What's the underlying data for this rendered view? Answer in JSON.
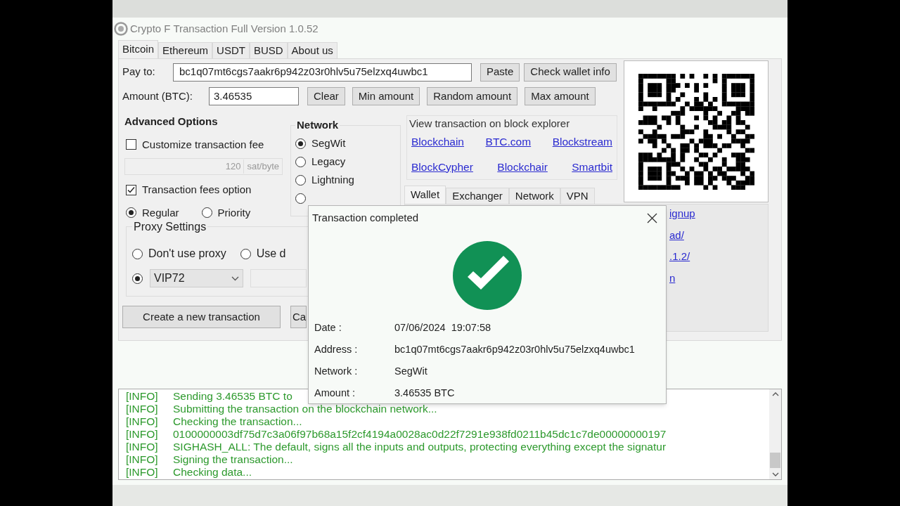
{
  "window": {
    "title": "Crypto F Transaction Full Version 1.0.52"
  },
  "tabs": [
    {
      "label": "Bitcoin",
      "selected": true
    },
    {
      "label": "Ethereum",
      "selected": false
    },
    {
      "label": "USDT",
      "selected": false
    },
    {
      "label": "BUSD",
      "selected": false
    },
    {
      "label": "About us",
      "selected": false
    }
  ],
  "pay_to": {
    "label": "Pay to:",
    "value": "bc1q07mt6cgs7aakr6p942z03r0hlv5u75elzxq4uwbc1",
    "buttons": [
      "Paste",
      "Check wallet info"
    ]
  },
  "amount": {
    "label": "Amount (BTC):",
    "value": "3.46535",
    "buttons": [
      "Clear",
      "Min amount",
      "Random amount",
      "Max amount"
    ]
  },
  "advanced_options": {
    "title": "Advanced Options",
    "customize_fee": {
      "label": "Customize transaction fee",
      "checked": false
    },
    "fee_value": "120",
    "fee_unit": "sat/byte",
    "fees_option": {
      "label": "Transaction fees option",
      "checked": true
    },
    "fee_modes": [
      {
        "label": "Regular",
        "selected": true
      },
      {
        "label": "Priority",
        "selected": false
      }
    ]
  },
  "network": {
    "title": "Network",
    "options": [
      {
        "label": "SegWit",
        "selected": true
      },
      {
        "label": "Legacy",
        "selected": false
      },
      {
        "label": "Lightning",
        "selected": false
      },
      {
        "selected": false
      }
    ]
  },
  "explorer": {
    "title": "View transaction on block explorer",
    "links": [
      "Blockchain",
      "BTC.com",
      "Blockstream",
      "BlockCypher",
      "Blockchair",
      "Smartbit"
    ]
  },
  "inner_tabs": [
    {
      "label": "Wallet",
      "selected": true
    },
    {
      "label": "Exchanger",
      "selected": false
    },
    {
      "label": "Network",
      "selected": false
    },
    {
      "label": "VPN",
      "selected": false
    }
  ],
  "inner_links": [
    "ignup",
    "ad/",
    ".1.2/",
    "n"
  ],
  "proxy": {
    "title": "Proxy Settings",
    "options": [
      {
        "label": "Don't use proxy",
        "selected": false
      },
      {
        "label": "Use d",
        "selected": false
      }
    ],
    "vip": {
      "selected": true,
      "value": "VIP72"
    }
  },
  "actions": [
    "Create a new transaction",
    "Ca"
  ],
  "dialog": {
    "title": "Transaction completed",
    "details": [
      {
        "label": "Date :",
        "value": "07/06/2024  19:07:58"
      },
      {
        "label": "Address :",
        "value": "bc1q07mt6cgs7aakr6p942z03r0hlv5u75elzxq4uwbc1"
      },
      {
        "label": "Network :",
        "value": "SegWit"
      },
      {
        "label": "Amount :",
        "value": "3.46535 BTC"
      }
    ]
  },
  "log": [
    {
      "tag": "[INFO]",
      "text": "Sending 3.46535 BTC to"
    },
    {
      "tag": "[INFO]",
      "text": "Submitting the transaction on the blockchain network..."
    },
    {
      "tag": "[INFO]",
      "text": "Checking the transaction..."
    },
    {
      "tag": "[INFO]",
      "text": "0100000003df75d7c3a06f97b68a15f2cf4194a0028ac0d22f7291e938fd0211b45dc1c7de00000000197"
    },
    {
      "tag": "[INFO]",
      "text": "SIGHASH_ALL: The default, signs all the inputs and outputs, protecting everything except the signatur"
    },
    {
      "tag": "[INFO]",
      "text": "Signing the transaction..."
    },
    {
      "tag": "[INFO]",
      "text": "Checking data..."
    }
  ]
}
